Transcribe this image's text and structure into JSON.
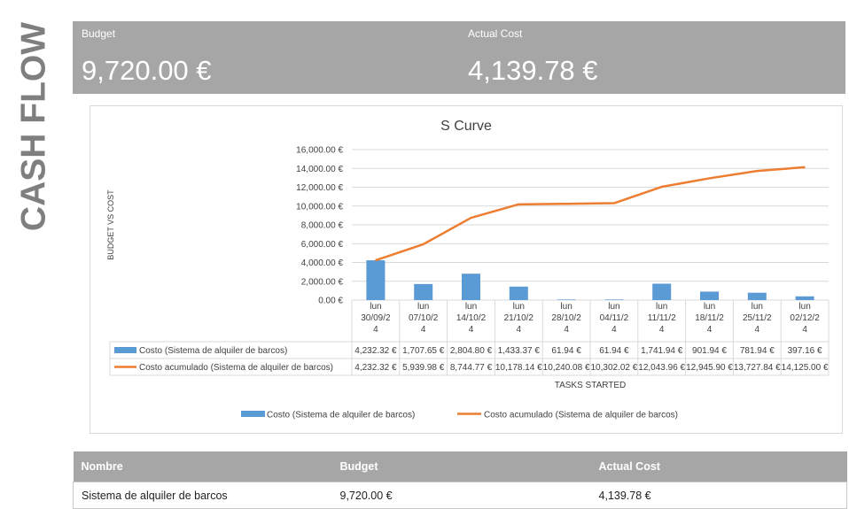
{
  "side_title": "CASH FLOW",
  "kpis": {
    "budget_label": "Budget",
    "budget_value": "9,720.00 €",
    "actual_label": "Actual  Cost",
    "actual_value": "4,139.78 €"
  },
  "chart_data": {
    "type": "bar",
    "title": "S Curve",
    "xlabel": "TASKS STARTED",
    "ylabel": "BUDGET VS COST",
    "ylim": [
      0,
      16000
    ],
    "y_ticks": [
      "0.00 €",
      "2,000.00 €",
      "4,000.00 €",
      "6,000.00 €",
      "8,000.00 €",
      "10,000.00 €",
      "12,000.00 €",
      "14,000.00 €",
      "16,000.00 €"
    ],
    "grid": true,
    "legend_position": "bottom",
    "categories": [
      [
        "lun",
        "30/09/2",
        "4"
      ],
      [
        "lun",
        "07/10/2",
        "4"
      ],
      [
        "lun",
        "14/10/2",
        "4"
      ],
      [
        "lun",
        "21/10/2",
        "4"
      ],
      [
        "lun",
        "28/10/2",
        "4"
      ],
      [
        "lun",
        "04/11/2",
        "4"
      ],
      [
        "lun",
        "11/11/2",
        "4"
      ],
      [
        "lun",
        "18/11/2",
        "4"
      ],
      [
        "lun",
        "25/11/2",
        "4"
      ],
      [
        "lun",
        "02/12/2",
        "4"
      ]
    ],
    "series": [
      {
        "name": "Costo (Sistema de alquiler de barcos)",
        "kind": "bar",
        "color": "#5b9bd5",
        "values": [
          4232.32,
          1707.65,
          2804.8,
          1433.37,
          61.94,
          61.94,
          1741.94,
          901.94,
          781.94,
          397.16
        ],
        "labels": [
          "4,232.32 €",
          "1,707.65 €",
          "2,804.80 €",
          "1,433.37 €",
          "61.94 €",
          "61.94 €",
          "1,741.94 €",
          "901.94 €",
          "781.94 €",
          "397.16 €"
        ]
      },
      {
        "name": "Costo acumulado (Sistema de alquiler de barcos)",
        "kind": "line",
        "color": "#ed7d31",
        "values": [
          4232.32,
          5939.98,
          8744.77,
          10178.14,
          10240.08,
          10302.02,
          12043.96,
          12945.9,
          13727.84,
          14125.0
        ],
        "labels": [
          "4,232.32 €",
          "5,939.98 €",
          "8,744.77 €",
          "10,178.14 €",
          "10,240.08 €",
          "10,302.02 €",
          "12,043.96 €",
          "12,945.90 €",
          "13,727.84 €",
          "14,125.00 €"
        ]
      }
    ]
  },
  "summary_table": {
    "headers": [
      "Nombre",
      "Budget",
      "Actual  Cost"
    ],
    "rows": [
      [
        "Sistema de alquiler de barcos",
        "9,720.00 €",
        "4,139.78 €"
      ]
    ]
  }
}
